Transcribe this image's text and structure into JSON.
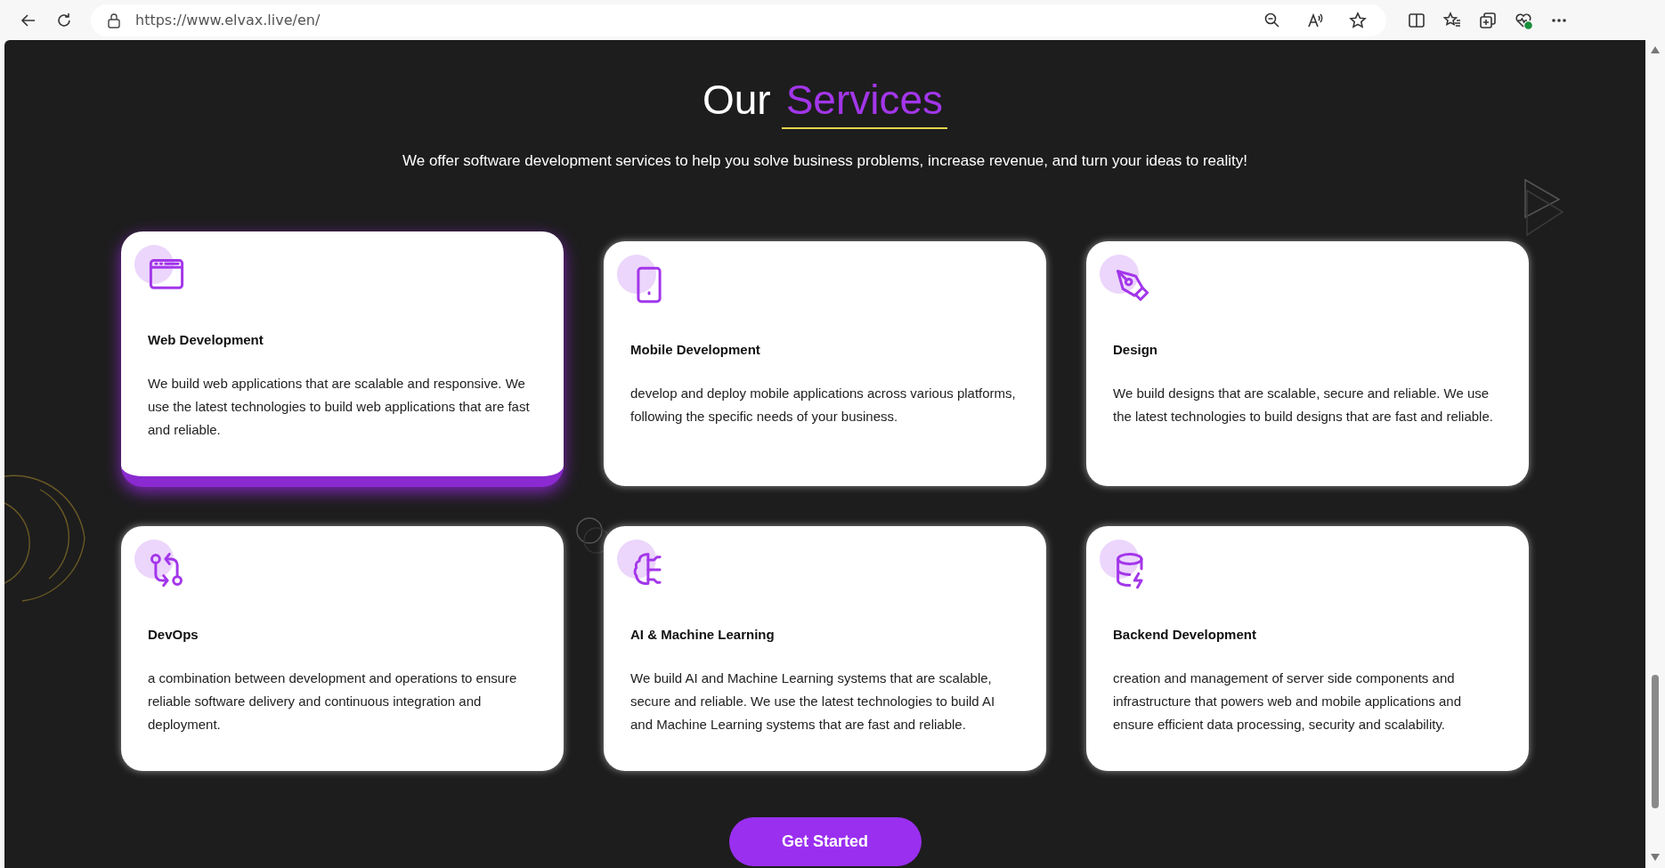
{
  "browser": {
    "url": "https://www.elvax.live/en/"
  },
  "header": {
    "title": "Our",
    "title_accent": "Services",
    "subtitle": "We offer software development services to help you solve business problems, increase revenue, and turn your ideas to reality!"
  },
  "services": [
    {
      "kind": "browser",
      "title": "Web Development",
      "text": "We build web applications that are scalable and responsive. We use the latest technologies to build web applications that are fast and reliable.",
      "selected": true
    },
    {
      "kind": "tablet",
      "title": "Mobile Development",
      "text": "develop and deploy mobile applications across various platforms, following the specific needs of your business.",
      "selected": false
    },
    {
      "kind": "pen",
      "title": "Design",
      "text": "We build designs that are scalable, secure and reliable. We use the latest technologies to build designs that are fast and reliable.",
      "selected": false
    },
    {
      "kind": "devops",
      "title": "DevOps",
      "text": "a combination between development and operations to ensure reliable software delivery and continuous integration and deployment.",
      "selected": false
    },
    {
      "kind": "ai",
      "title": "AI & Machine Learning",
      "text": "We build AI and Machine Learning systems that are scalable, secure and reliable. We use the latest technologies to build AI and Machine Learning systems that are fast and reliable.",
      "selected": false
    },
    {
      "kind": "database",
      "title": "Backend Development",
      "text": "creation and management of server side components and infrastructure that powers web and mobile applications and ensure efficient data processing, security and scalability.",
      "selected": false
    }
  ],
  "cta": {
    "label": "Get Started"
  }
}
